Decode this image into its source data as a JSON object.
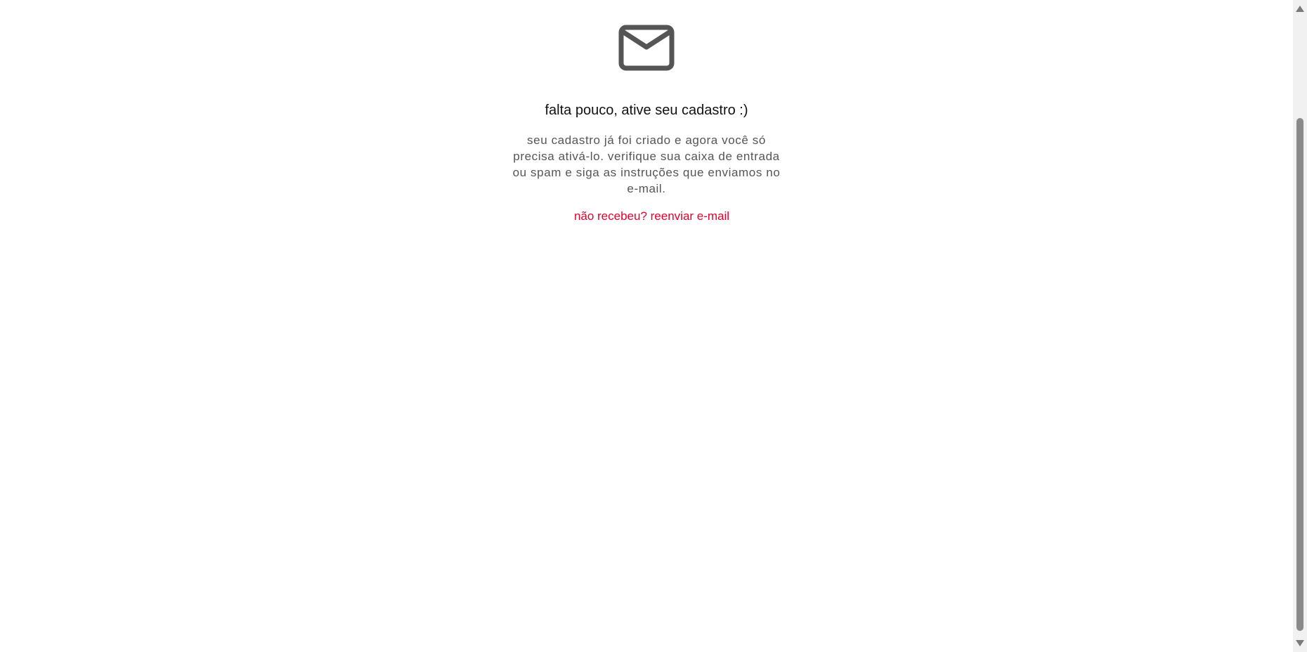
{
  "activation": {
    "icon": "mail-envelope-icon",
    "headline": "falta pouco, ative seu cadastro :)",
    "description": "seu cadastro já foi criado e agora você só precisa ativá-lo. verifique sua caixa de entrada ou spam e siga as instruções que enviamos no e-mail.",
    "resend_link": "não recebeu? reenviar e-mail"
  },
  "colors": {
    "icon": "#555555",
    "headline": "#111111",
    "description": "#555555",
    "link": "#e4002b",
    "scrollbar_track": "#f1f1f1",
    "scrollbar_thumb": "#8a8a8a"
  }
}
